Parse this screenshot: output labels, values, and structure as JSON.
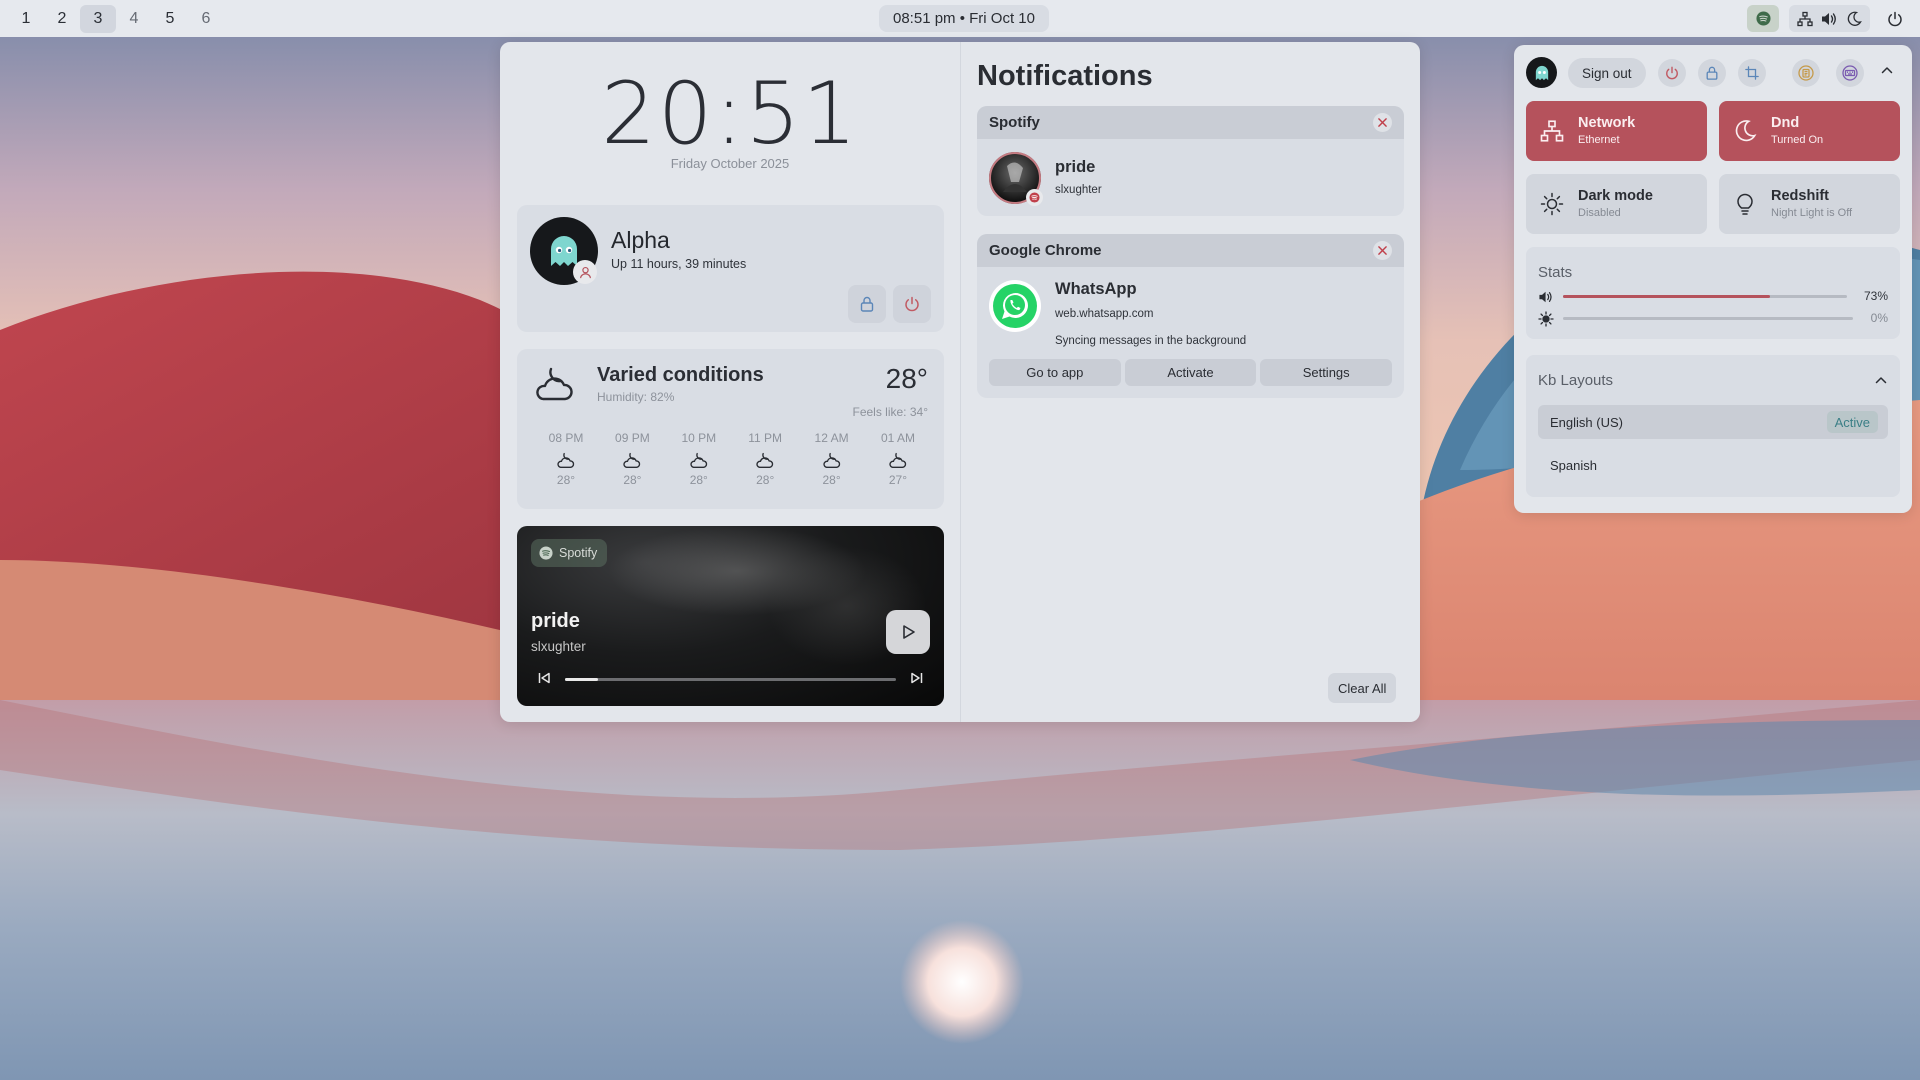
{
  "topbar": {
    "workspaces": [
      "1",
      "2",
      "3",
      "4",
      "5",
      "6"
    ],
    "active_workspace": "3",
    "datetime": "08:51 pm • Fri Oct 10",
    "tray_icons": [
      "spotify-icon",
      "network-icon",
      "volume-icon",
      "moon-icon",
      "power-icon"
    ]
  },
  "clock": {
    "time": "20:51",
    "date": "Friday October 2025"
  },
  "user": {
    "name": "Alpha",
    "uptime": "Up 11 hours, 39 minutes"
  },
  "weather": {
    "condition": "Varied conditions",
    "humidity": "Humidity: 82%",
    "temp": "28°",
    "feels_like": "Feels like: 34°",
    "hourly": [
      {
        "time": "08 PM",
        "temp": "28°"
      },
      {
        "time": "09 PM",
        "temp": "28°"
      },
      {
        "time": "10 PM",
        "temp": "28°"
      },
      {
        "time": "11 PM",
        "temp": "28°"
      },
      {
        "time": "12 AM",
        "temp": "28°"
      },
      {
        "time": "01 AM",
        "temp": "27°"
      }
    ]
  },
  "media": {
    "source": "Spotify",
    "title": "pride",
    "artist": "slxughter",
    "progress": 0.1
  },
  "notifications": {
    "title": "Notifications",
    "items": [
      {
        "app": "Spotify",
        "title": "pride",
        "subtitle": "slxughter"
      },
      {
        "app": "Google Chrome",
        "title": "WhatsApp",
        "subtitle": "web.whatsapp.com",
        "body": "Syncing messages in the background",
        "actions": [
          "Go to app",
          "Activate",
          "Settings"
        ]
      }
    ],
    "clear_all": "Clear All"
  },
  "quick_settings": {
    "sign_out": "Sign out",
    "tiles": [
      {
        "title": "Network",
        "subtitle": "Ethernet",
        "on": true,
        "icon": "network-icon"
      },
      {
        "title": "Dnd",
        "subtitle": "Turned On",
        "on": true,
        "icon": "moon-icon"
      },
      {
        "title": "Dark mode",
        "subtitle": "Disabled",
        "on": false,
        "icon": "sun-icon"
      },
      {
        "title": "Redshift",
        "subtitle": "Night Light is Off",
        "on": false,
        "icon": "bulb-icon"
      }
    ],
    "stats": {
      "title": "Stats",
      "volume": {
        "label": "73%",
        "value": 0.73
      },
      "brightness": {
        "label": "0%",
        "value": 0.0
      }
    },
    "kb_layouts": {
      "title": "Kb Layouts",
      "items": [
        {
          "name": "English (US)",
          "badge": "Active"
        },
        {
          "name": "Spanish"
        }
      ]
    }
  },
  "colors": {
    "accent": "#b5525c",
    "panel": "#e3e6eb",
    "card": "#d9dde4",
    "active_badge_text": "#3b7f86"
  }
}
